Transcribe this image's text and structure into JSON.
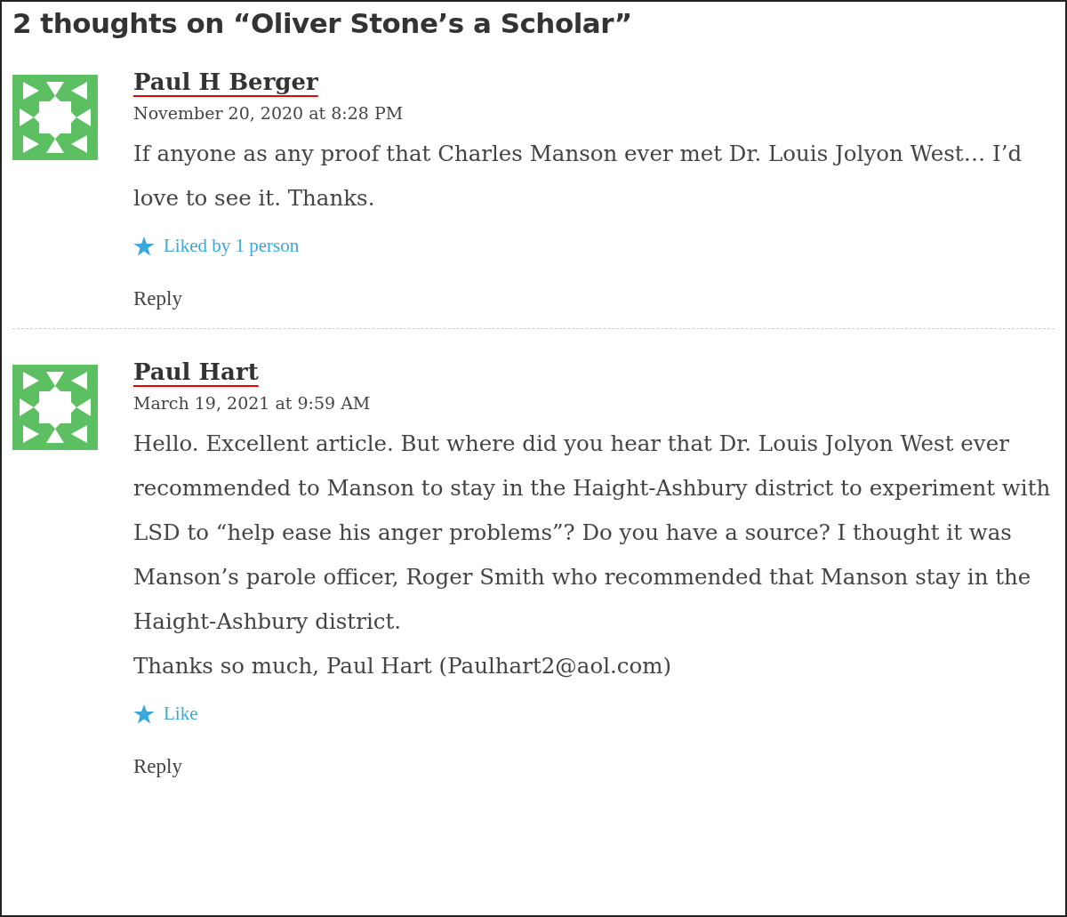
{
  "heading": "2 thoughts on “Oliver Stone’s a Scholar”",
  "comments": [
    {
      "author": "Paul H Berger",
      "date": "November 20, 2020 at 8:28 PM",
      "body": [
        "If anyone as any proof that Charles Manson ever met Dr. Louis Jolyon West… I’d love to see it. Thanks."
      ],
      "like": "Liked by 1 person",
      "reply": "Reply"
    },
    {
      "author": "Paul Hart",
      "date": "March 19, 2021 at 9:59 AM",
      "body": [
        "Hello. Excellent article. But where did you hear that Dr. Louis Jolyon West ever recommended to Manson to stay in the Haight-Ashbury district to experiment with LSD to “help ease his anger problems”? Do you have a source? I thought it was Manson’s parole officer, Roger Smith who recommended that Manson stay in the Haight-Ashbury district.",
        "Thanks so much, Paul Hart (Paulhart2@aol.com)"
      ],
      "like": "Like",
      "reply": "Reply"
    }
  ]
}
